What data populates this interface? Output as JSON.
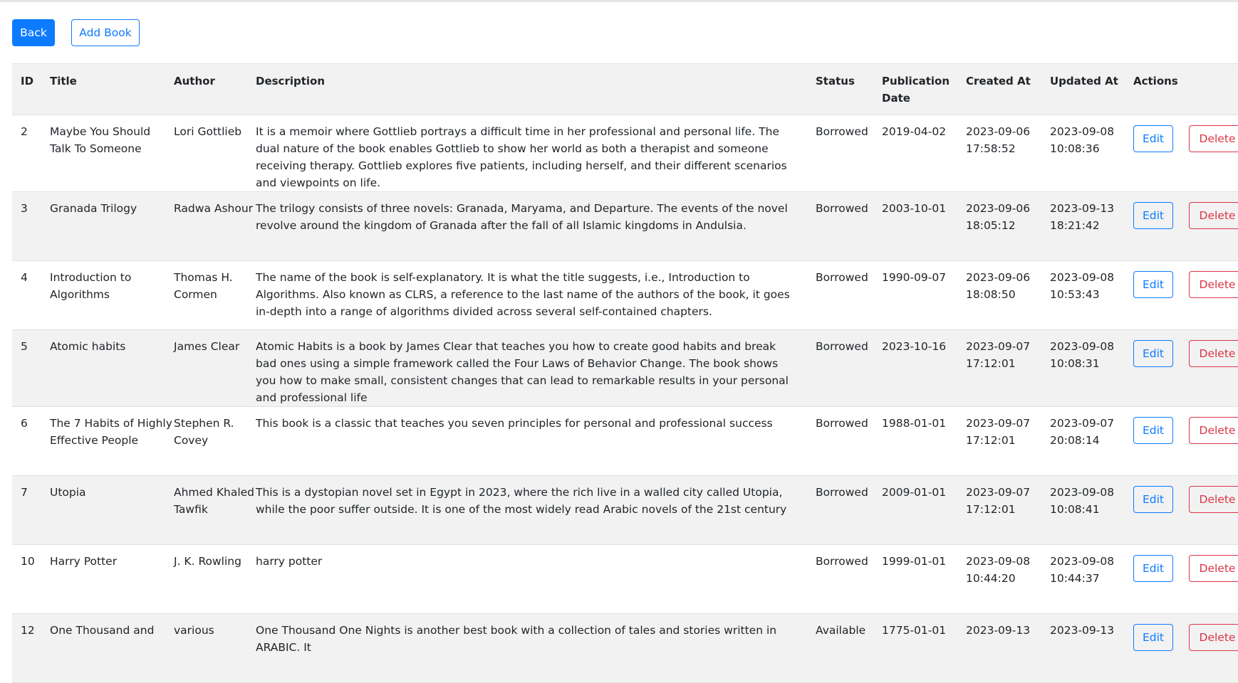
{
  "toolbar": {
    "back_label": "Back",
    "add_label": "Add Book"
  },
  "table": {
    "headers": {
      "id": "ID",
      "title": "Title",
      "author": "Author",
      "description": "Description",
      "status": "Status",
      "publication_date": "Publication Date",
      "created_at": "Created At",
      "updated_at": "Updated At",
      "actions": "Actions"
    },
    "edit_label": "Edit",
    "delete_label": "Delete",
    "rows": [
      {
        "id": "2",
        "title": "Maybe You Should Talk To Someone",
        "author": "Lori Gottlieb",
        "description": "It is a memoir where Gottlieb portrays a difficult time in her professional and personal life. The dual nature of the book enables Gottlieb to show her world as both a therapist and someone receiving therapy. Gottlieb explores five patients, including herself, and their different scenarios and viewpoints on life.",
        "status": "Borrowed",
        "publication_date": "2019-04-02",
        "created_at": "2023-09-06 17:58:52",
        "updated_at": "2023-09-08 10:08:36"
      },
      {
        "id": "3",
        "title": "Granada Trilogy",
        "author": "Radwa Ashour",
        "description": "The trilogy consists of three novels: Granada, Maryama, and Departure. The events of the novel revolve around the kingdom of Granada after the fall of all Islamic kingdoms in Andulsia.",
        "status": "Borrowed",
        "publication_date": "2003-10-01",
        "created_at": "2023-09-06 18:05:12",
        "updated_at": "2023-09-13 18:21:42"
      },
      {
        "id": "4",
        "title": "Introduction to Algorithms",
        "author": "Thomas H. Cormen",
        "description": "The name of the book is self-explanatory. It is what the title suggests, i.e., Introduction to Algorithms. Also known as CLRS, a reference to the last name of the authors of the book, it goes in-depth into a range of algorithms divided across several self-contained chapters.",
        "status": "Borrowed",
        "publication_date": "1990-09-07",
        "created_at": "2023-09-06 18:08:50",
        "updated_at": "2023-09-08 10:53:43"
      },
      {
        "id": "5",
        "title": "Atomic habits",
        "author": "James Clear",
        "description": "Atomic Habits is a book by James Clear that teaches you how to create good habits and break bad ones using a simple framework called the Four Laws of Behavior Change. The book shows you how to make small, consistent changes that can lead to remarkable results in your personal and professional life",
        "status": "Borrowed",
        "publication_date": "2023-10-16",
        "created_at": "2023-09-07 17:12:01",
        "updated_at": "2023-09-08 10:08:31"
      },
      {
        "id": "6",
        "title": "The 7 Habits of Highly Effective People",
        "author": "Stephen R. Covey",
        "description": "This book is a classic that teaches you seven principles for personal and professional success",
        "status": "Borrowed",
        "publication_date": "1988-01-01",
        "created_at": "2023-09-07 17:12:01",
        "updated_at": "2023-09-07 20:08:14"
      },
      {
        "id": "7",
        "title": "Utopia",
        "author": "Ahmed Khaled Tawfik",
        "description": "This is a dystopian novel set in Egypt in 2023, where the rich live in a walled city called Utopia, while the poor suffer outside. It is one of the most widely read Arabic novels of the 21st century",
        "status": "Borrowed",
        "publication_date": "2009-01-01",
        "created_at": "2023-09-07 17:12:01",
        "updated_at": "2023-09-08 10:08:41"
      },
      {
        "id": "10",
        "title": "Harry Potter",
        "author": "J. K. Rowling",
        "description": "harry potter",
        "status": "Borrowed",
        "publication_date": "1999-01-01",
        "created_at": "2023-09-08 10:44:20",
        "updated_at": "2023-09-08 10:44:37"
      },
      {
        "id": "12",
        "title": "One Thousand and",
        "author": "various",
        "description": "One Thousand One Nights is another best book with a collection of tales and stories written in ARABIC. It",
        "status": "Available",
        "publication_date": "1775-01-01",
        "created_at": "2023-09-13",
        "updated_at": "2023-09-13"
      }
    ]
  },
  "colors": {
    "primary": "#0d7bff",
    "danger": "#dc3545",
    "stripe": "#f2f2f2",
    "border": "#dee2e6"
  }
}
